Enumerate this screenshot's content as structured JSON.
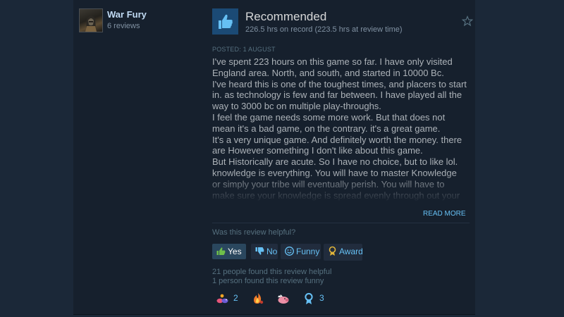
{
  "author": {
    "name": "War Fury",
    "review_count": "6 reviews"
  },
  "review": {
    "verdict": "Recommended",
    "hours": "226.5 hrs on record (223.5 hrs at review time)",
    "posted": "POSTED: 1 AUGUST",
    "lines": [
      "I've spent 223 hours on this game so far. I have only visited England area. North, and south, and started in 10000 Bc.",
      "I've heard this is one of the toughest times, and placers to start in. as technology is few and far between. I have played all the way to 3000 bc on multiple play-throughs.",
      "I feel the game needs some more work. But that does not mean it's a bad game, on the contrary. it's a great game.",
      "It's a very unique game. And definitely worth the money. there are However something I don't like about this game.",
      "But Historically are acute. So I have no choice, but to like lol. knowledge is everything. You will have to master Knowledge or simply your tribe will eventually perish. You will have to make sure your knowledge is spread evenly through out your tribe, as"
    ],
    "read_more": "READ MORE"
  },
  "feedback": {
    "question": "Was this review helpful?",
    "yes_label": "Yes",
    "no_label": "No",
    "funny_label": "Funny",
    "award_label": "Award",
    "helpful_count": "21 people found this review helpful",
    "funny_count": "1 person found this review funny"
  },
  "awards": [
    {
      "icon": "award-worm-icon",
      "count": "2"
    },
    {
      "icon": "award-flame-icon",
      "count": ""
    },
    {
      "icon": "award-pig-icon",
      "count": ""
    },
    {
      "icon": "award-ribbon-icon",
      "count": "3"
    }
  ],
  "colors": {
    "page_bg": "#1b2838",
    "card_bg": "#16202d",
    "link": "#66c0f4",
    "thumb_bg": "#1b4a75"
  }
}
